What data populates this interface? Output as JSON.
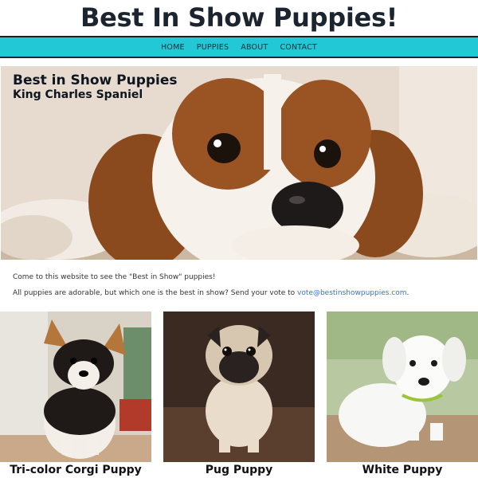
{
  "site": {
    "title": "Best In Show Puppies!"
  },
  "nav": {
    "items": [
      {
        "label": "HOME"
      },
      {
        "label": "PUPPIES"
      },
      {
        "label": "ABOUT"
      },
      {
        "label": "CONTACT"
      }
    ],
    "accent_color": "#22c8d6"
  },
  "hero": {
    "title": "Best in Show Puppies",
    "subtitle": "King Charles Spaniel"
  },
  "intro": {
    "line1": "Come to this website to see the \"Best in Show\" puppies!",
    "line2_prefix": "All puppies are adorable, but which one is the best in show? Send your vote to ",
    "email": "vote@bestinshowpuppies.com",
    "line2_suffix": "."
  },
  "puppies": [
    {
      "name": "Tri-color Corgi Puppy"
    },
    {
      "name": "Pug Puppy"
    },
    {
      "name": "White Puppy"
    }
  ]
}
